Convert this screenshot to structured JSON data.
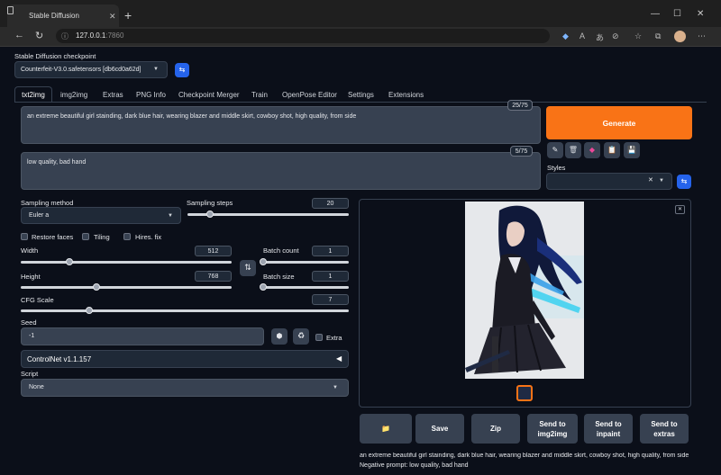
{
  "browser": {
    "tab_title": "Stable Diffusion",
    "url_host": "127.0.0.1",
    "url_port": ":7860",
    "new_tab": "+",
    "tab_close": "✕",
    "back": "←",
    "reload": "↻",
    "info": "ⓘ",
    "min": "—",
    "max": "☐",
    "close": "✕"
  },
  "checkpoint": {
    "label": "Stable Diffusion checkpoint",
    "value": "Counterfeit-V3.0.safetensors [db6cd0a62d]"
  },
  "tabs": [
    "txt2img",
    "img2img",
    "Extras",
    "PNG Info",
    "Checkpoint Merger",
    "Train",
    "OpenPose Editor",
    "Settings",
    "Extensions"
  ],
  "prompt": {
    "positive": "an extreme beautiful girl stainding, dark blue hair, wearing blazer and middle skirt, cowboy shot, high quality, from side",
    "positive_count": "25/75",
    "negative": "low quality, bad hand",
    "negative_count": "5/75"
  },
  "generate_label": "Generate",
  "tool_icons": [
    "✎",
    "🗑",
    "◆",
    "📋",
    "💾"
  ],
  "styles": {
    "label": "Styles",
    "clear": "✕"
  },
  "sampling": {
    "method_label": "Sampling method",
    "method_value": "Euler a",
    "steps_label": "Sampling steps",
    "steps_value": "20",
    "steps_fraction": 0.14
  },
  "options": {
    "restore_faces": "Restore faces",
    "tiling": "Tiling",
    "hires": "Hires. fix"
  },
  "width": {
    "label": "Width",
    "value": "512",
    "fraction": 0.23
  },
  "height": {
    "label": "Height",
    "value": "768",
    "fraction": 0.36
  },
  "swap_icon": "⇅",
  "batch_count": {
    "label": "Batch count",
    "value": "1",
    "fraction": 0.0
  },
  "batch_size": {
    "label": "Batch size",
    "value": "1",
    "fraction": 0.0
  },
  "cfg": {
    "label": "CFG Scale",
    "value": "7",
    "fraction": 0.21
  },
  "seed": {
    "label": "Seed",
    "value": "-1",
    "extra": "Extra"
  },
  "controlnet": {
    "label": "ControlNet v1.1.157",
    "toggle": "◀"
  },
  "script": {
    "label": "Script",
    "value": "None"
  },
  "output": {
    "close": "✕",
    "buttons": [
      "📁",
      "Save",
      "Zip",
      "Send to\nimg2img",
      "Send to\ninpaint",
      "Send to\nextras"
    ],
    "info_line1": "an extreme beautiful girl stainding, dark blue hair, wearing blazer and middle skirt, cowboy shot, high quality, from side",
    "info_line2": "Negative prompt: low quality, bad hand"
  },
  "colors": {
    "accent": "#f97316",
    "bg": "#0b0f19",
    "panel": "#1f2937",
    "blue": "#2563eb"
  }
}
